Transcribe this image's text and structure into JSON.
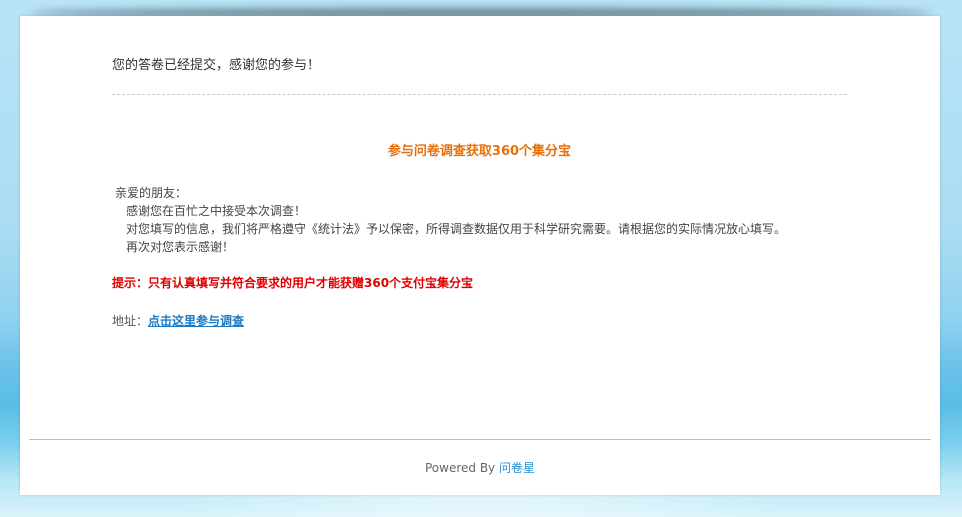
{
  "message": {
    "thanks": "您的答卷已经提交，感谢您的参与！"
  },
  "survey": {
    "title": "参与问卷调查获取360个集分宝",
    "greeting": "亲爱的朋友：",
    "lines": [
      "感谢您在百忙之中接受本次调查！",
      "对您填写的信息，我们将严格遵守《统计法》予以保密，所得调查数据仅用于科学研究需要。请根据您的实际情况放心填写。",
      "再次对您表示感谢！"
    ],
    "tip": "提示：只有认真填写并符合要求的用户才能获赠360个支付宝集分宝",
    "address_label": "地址：",
    "address_link": "点击这里参与调查"
  },
  "footer": {
    "powered_by": "Powered By",
    "brand": "问卷星"
  },
  "colors": {
    "title_orange": "#e8700a",
    "tip_red": "#e00000",
    "link_blue": "#1a7ac4",
    "brand_blue": "#2a8fd0"
  }
}
